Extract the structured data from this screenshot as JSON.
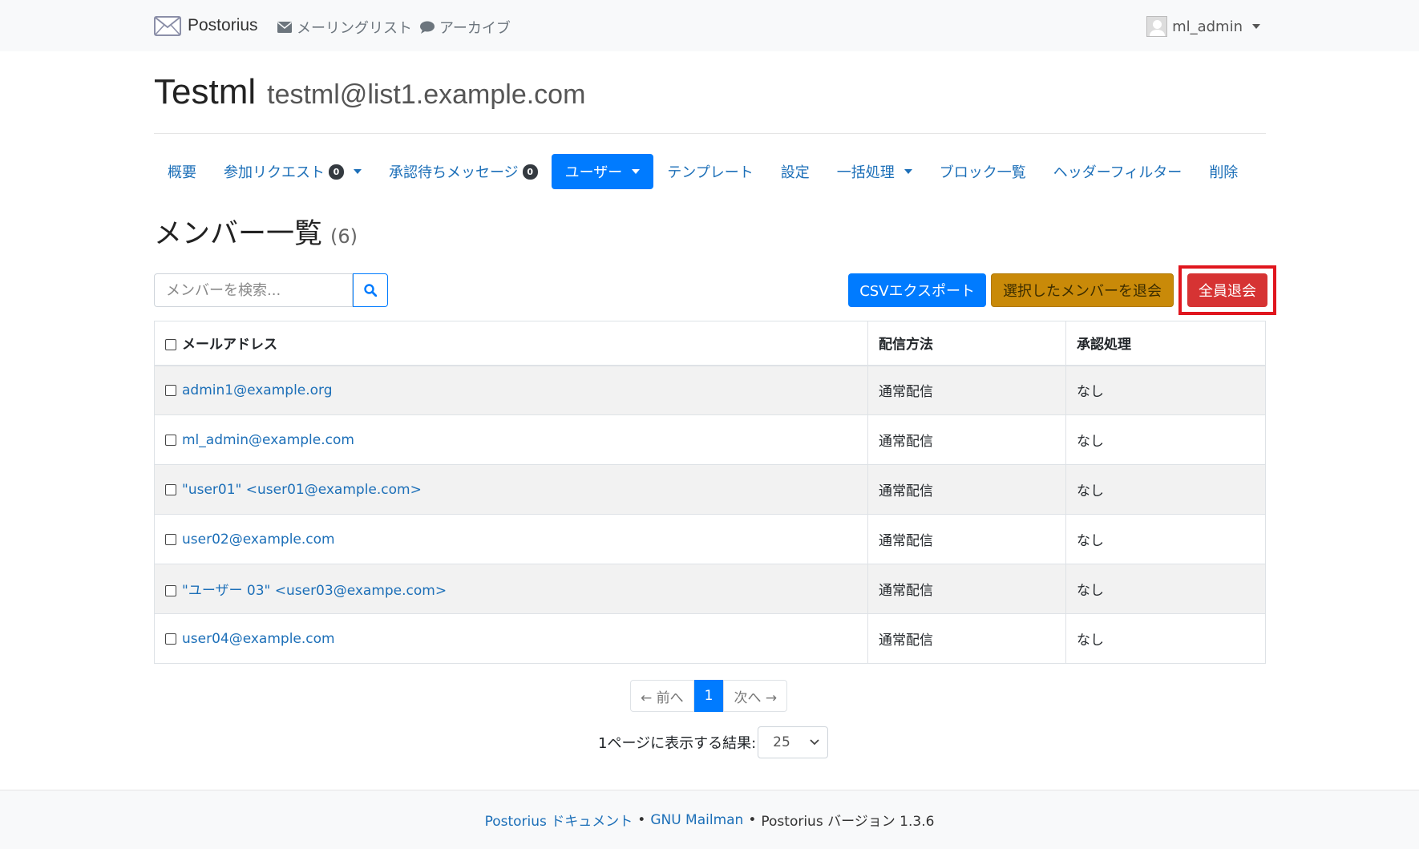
{
  "navbar": {
    "brand": "Postorius",
    "links": [
      {
        "label": "メーリングリスト",
        "icon": "envelope-icon"
      },
      {
        "label": "アーカイブ",
        "icon": "comment-icon"
      }
    ],
    "user": "ml_admin"
  },
  "list": {
    "name": "Testml",
    "address": "testml@list1.example.com"
  },
  "tabs": [
    {
      "label": "概要"
    },
    {
      "label": "参加リクエスト",
      "badge": "0",
      "dropdown": true
    },
    {
      "label": "承認待ちメッセージ",
      "badge": "0"
    },
    {
      "label": "ユーザー",
      "dropdown": true,
      "active": true
    },
    {
      "label": "テンプレート"
    },
    {
      "label": "設定"
    },
    {
      "label": "一括処理",
      "dropdown": true
    },
    {
      "label": "ブロック一覧"
    },
    {
      "label": "ヘッダーフィルター"
    },
    {
      "label": "削除"
    }
  ],
  "page": {
    "heading": "メンバー一覧",
    "count": "(6)"
  },
  "search": {
    "placeholder": "メンバーを検索..."
  },
  "actions": {
    "csv_export": "CSVエクスポート",
    "unsubscribe_selected": "選択したメンバーを退会",
    "unsubscribe_all": "全員退会"
  },
  "table": {
    "headers": [
      "メールアドレス",
      "配信方法",
      "承認処理"
    ],
    "rows": [
      {
        "email": "admin1@example.org",
        "delivery": "通常配信",
        "moderation": "なし"
      },
      {
        "email": "ml_admin@example.com",
        "delivery": "通常配信",
        "moderation": "なし"
      },
      {
        "email": "\"user01\" <user01@example.com>",
        "delivery": "通常配信",
        "moderation": "なし"
      },
      {
        "email": "user02@example.com",
        "delivery": "通常配信",
        "moderation": "なし"
      },
      {
        "email": "\"ユーザー 03\" <user03@exampe.com>",
        "delivery": "通常配信",
        "moderation": "なし"
      },
      {
        "email": "user04@example.com",
        "delivery": "通常配信",
        "moderation": "なし"
      }
    ]
  },
  "pagination": {
    "prev": "← 前へ",
    "current": "1",
    "next": "次へ →"
  },
  "per_page": {
    "label": "1ページに表示する結果:",
    "value": "25"
  },
  "footer": {
    "docs_link": "Postorius ドキュメント",
    "mailman_link": "GNU Mailman",
    "version": "Postorius バージョン 1.3.6",
    "separator": "•"
  },
  "colors": {
    "primary": "#007bff",
    "link": "#1c6fb8",
    "warning": "#c98a09",
    "danger": "#d63333",
    "highlight": "#e0161e"
  }
}
